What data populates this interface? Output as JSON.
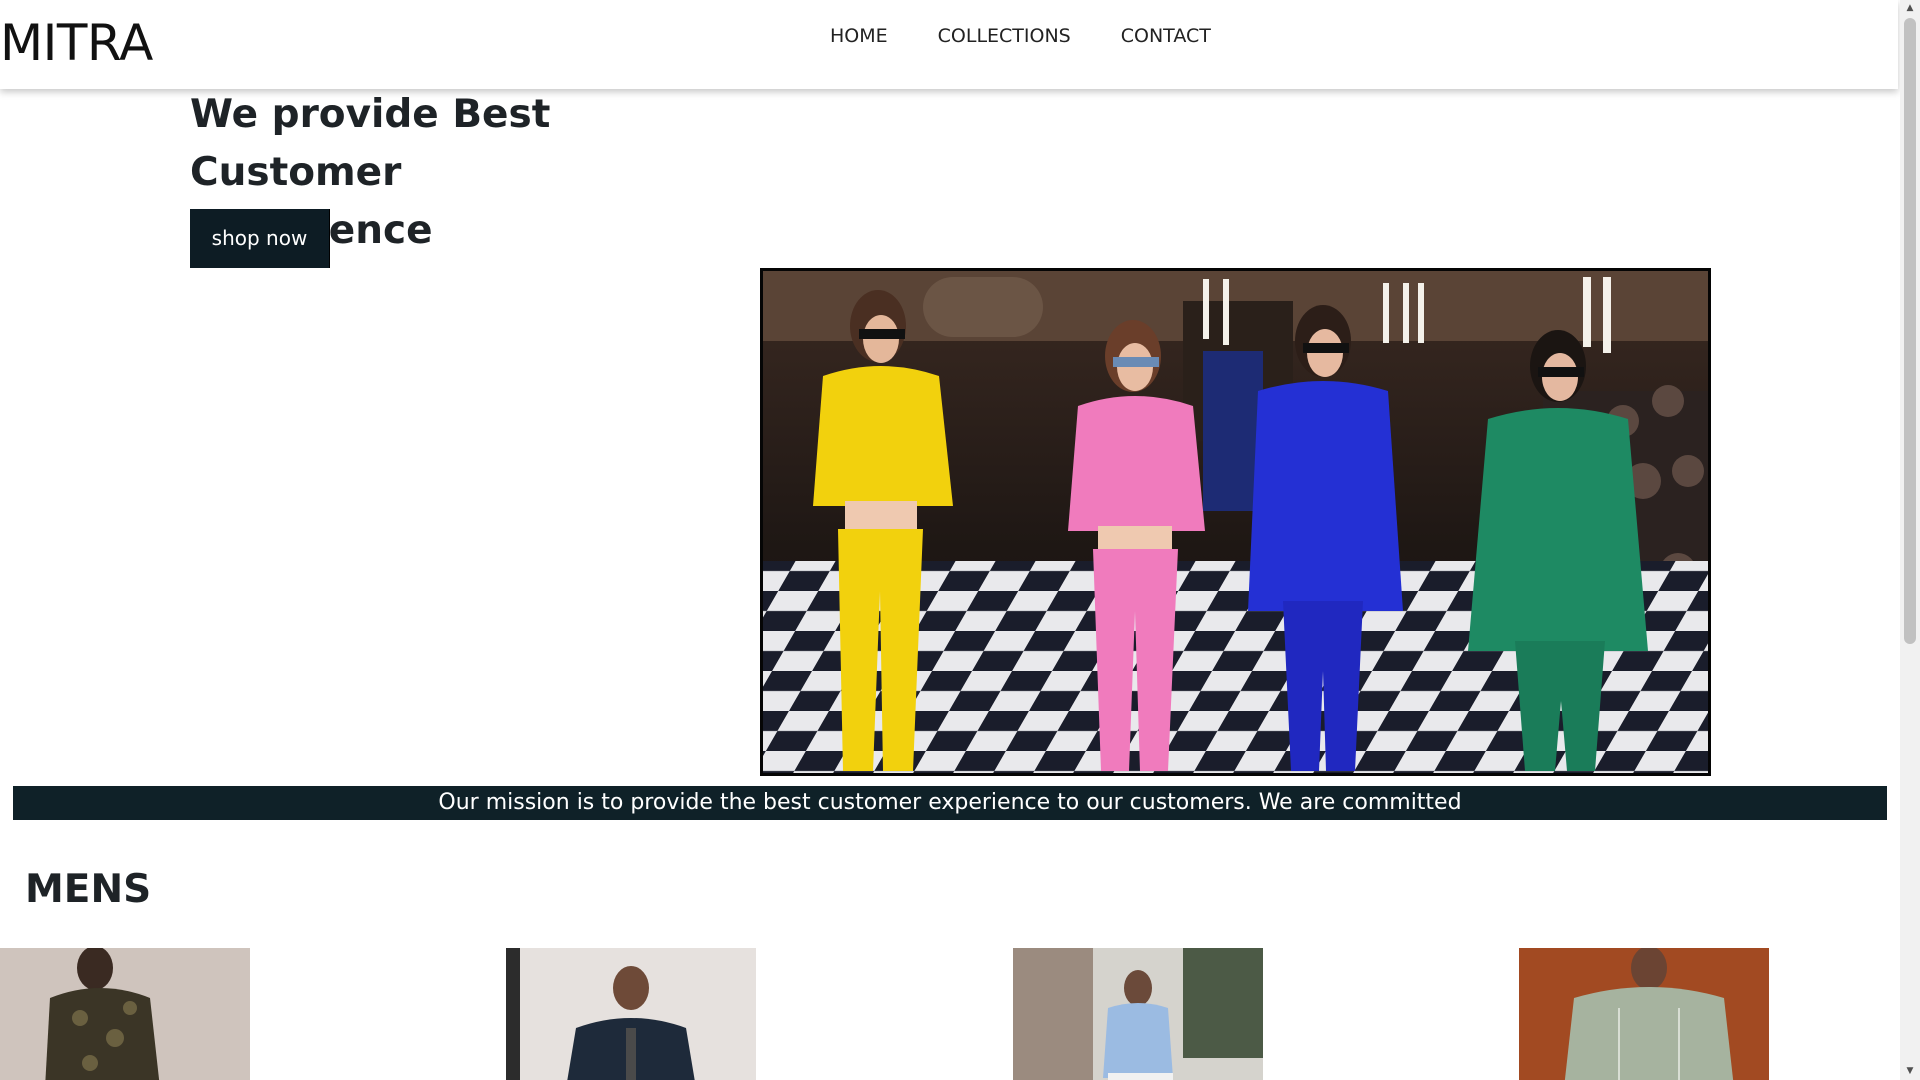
{
  "header": {
    "logo": "MITRA",
    "nav": [
      {
        "label": "HOME"
      },
      {
        "label": "COLLECTIONS"
      },
      {
        "label": "CONTACT"
      }
    ]
  },
  "hero": {
    "title_line1": "We provide Best",
    "title_line2": "Customer Experience",
    "cta_label": "shop now"
  },
  "mission": {
    "text": "Our mission is to provide the best customer experience to our customers. We are committed"
  },
  "mens": {
    "title": "MENS"
  },
  "colors": {
    "accent_dark": "#0d1c24",
    "mission_bg": "#0f2128",
    "text": "#1e2327"
  }
}
